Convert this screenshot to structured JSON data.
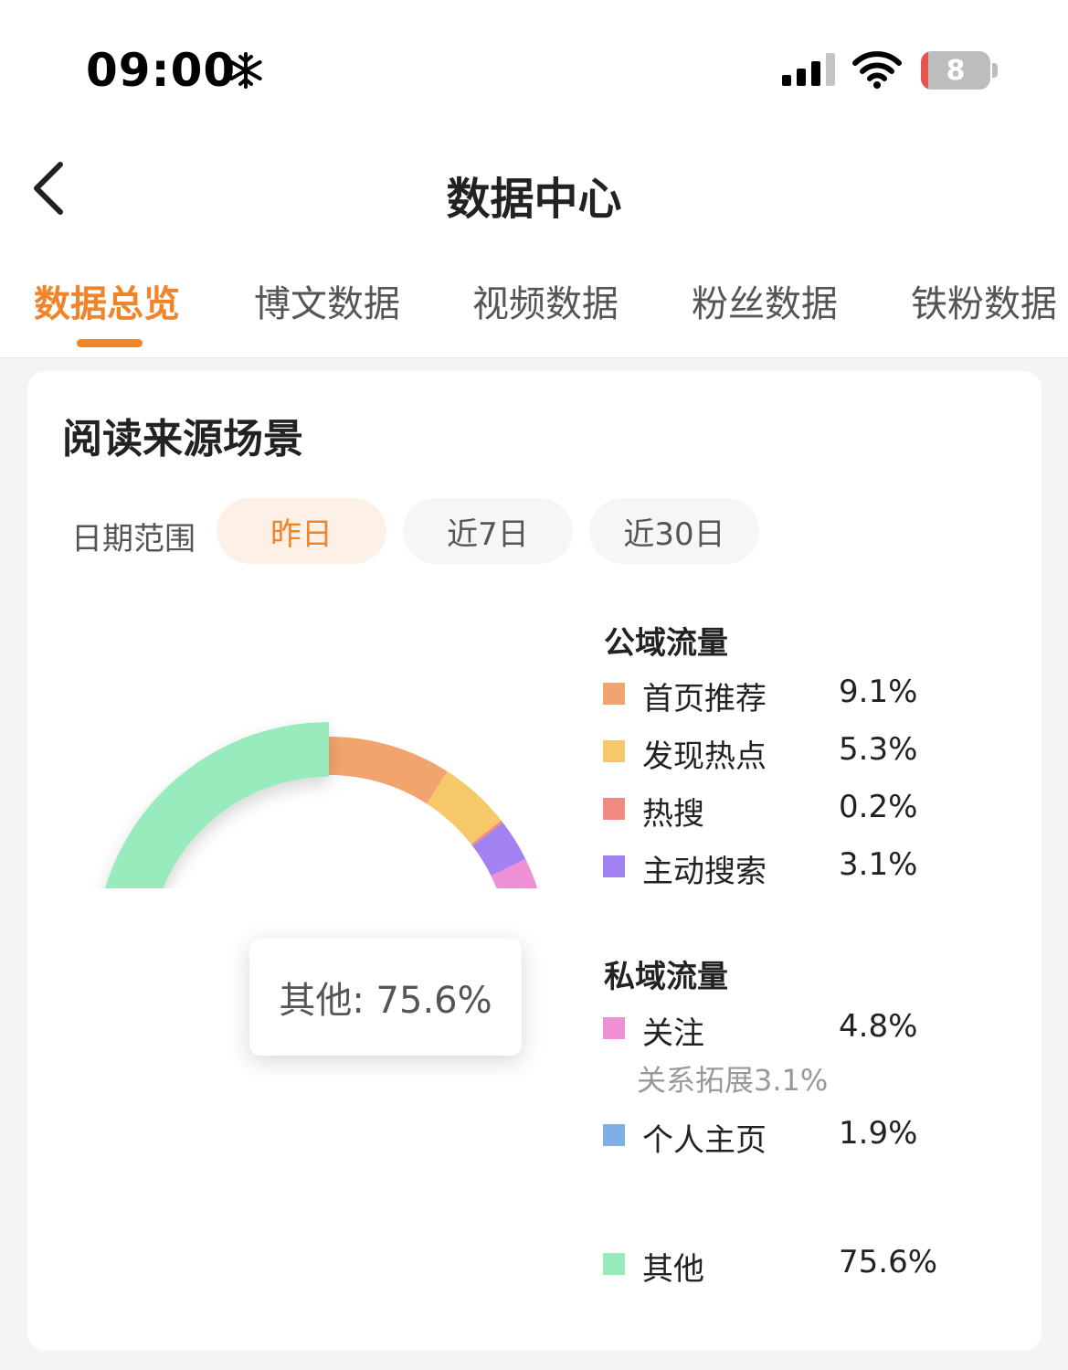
{
  "status_bar": {
    "time": "09:00",
    "battery_level": "8",
    "icons": [
      "snowflake-icon",
      "cellular-signal-icon",
      "wifi-icon",
      "battery-icon"
    ]
  },
  "header": {
    "title": "数据中心",
    "back_icon": "chevron-left-icon"
  },
  "tabs": [
    {
      "label": "数据总览",
      "active": true
    },
    {
      "label": "博文数据",
      "active": false
    },
    {
      "label": "视频数据",
      "active": false
    },
    {
      "label": "粉丝数据",
      "active": false
    },
    {
      "label": "铁粉数据",
      "active": false
    }
  ],
  "card": {
    "title": "阅读来源场景",
    "date_range": {
      "label": "日期范围",
      "options": [
        "昨日",
        "近7日",
        "近30日"
      ],
      "selected": "昨日"
    }
  },
  "legend": {
    "public": {
      "title": "公域流量",
      "items": [
        {
          "label": "首页推荐",
          "value": "9.1%",
          "color": "#f2a46e"
        },
        {
          "label": "发现热点",
          "value": "5.3%",
          "color": "#f7c86a"
        },
        {
          "label": "热搜",
          "value": "0.2%",
          "color": "#f08b84"
        },
        {
          "label": "主动搜索",
          "value": "3.1%",
          "color": "#a182f0"
        }
      ]
    },
    "private": {
      "title": "私域流量",
      "items": [
        {
          "label": "关注",
          "value": "4.8%",
          "color": "#ef8fd6",
          "sub": "关系拓展3.1%"
        },
        {
          "label": "个人主页",
          "value": "1.9%",
          "color": "#7eb0e6"
        }
      ]
    },
    "other": {
      "label": "其他",
      "value": "75.6%",
      "color": "#98ebbd"
    }
  },
  "tooltip": "其他: 75.6%",
  "chart_data": {
    "type": "pie",
    "donut": true,
    "categories": [
      "首页推荐",
      "发现热点",
      "热搜",
      "主动搜索",
      "关注",
      "个人主页",
      "其他"
    ],
    "values": [
      9.1,
      5.3,
      0.2,
      3.1,
      4.8,
      1.9,
      75.6
    ],
    "colors": [
      "#f2a46e",
      "#f7c86a",
      "#f08b84",
      "#a182f0",
      "#ef8fd6",
      "#7eb0e6",
      "#98ebbd"
    ],
    "highlighted": "其他",
    "tooltip": "其他: 75.6%"
  },
  "colors": {
    "accent": "#f08428",
    "chip_active_bg": "#fdf1e7",
    "chip_bg": "#f6f6f6",
    "page_bg": "#f4f4f6"
  }
}
